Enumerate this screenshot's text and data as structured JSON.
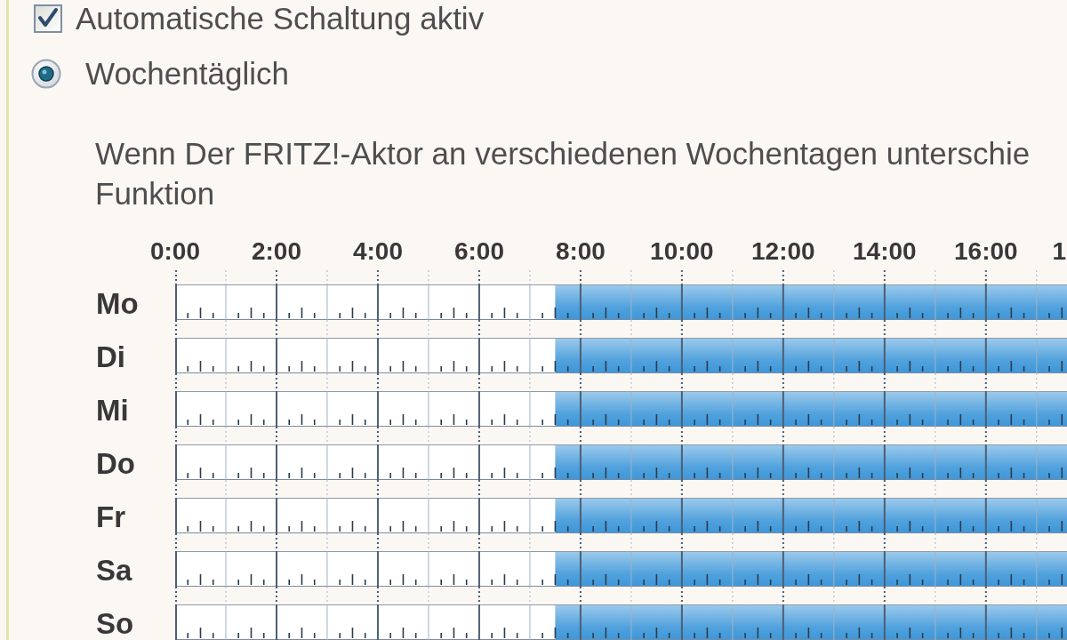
{
  "auto_switch": {
    "label": "Automatische Schaltung aktiv",
    "checked": true
  },
  "schedule_modes": [
    {
      "label": "Wochentäglich",
      "selected": true
    }
  ],
  "description_lines": [
    "Wenn Der FRITZ!-Aktor an verschiedenen Wochentagen unterschie",
    "Funktion"
  ],
  "timeline": {
    "chart_data": {
      "type": "bar",
      "orientation": "horizontal",
      "stacked": true,
      "categories": [
        "Mo",
        "Di",
        "Mi",
        "Do",
        "Fr",
        "Sa",
        "So"
      ],
      "series": [
        {
          "color": "#ffffff",
          "values": [
            7.5,
            7.5,
            7.5,
            7.5,
            7.5,
            7.5,
            7.5
          ]
        },
        {
          "color": "#3d97d9",
          "values": [
            10.1,
            10.1,
            10.1,
            10.1,
            10.1,
            10.1,
            10.1
          ]
        }
      ],
      "xlim": [
        0,
        17.6
      ],
      "xticks": [
        {
          "value": 0,
          "label": "0:00"
        },
        {
          "value": 2,
          "label": "2:00"
        },
        {
          "value": 4,
          "label": "4:00"
        },
        {
          "value": 6,
          "label": "6:00"
        },
        {
          "value": 8,
          "label": "8:00"
        },
        {
          "value": 10,
          "label": "10:00"
        },
        {
          "value": 12,
          "label": "12:00"
        },
        {
          "value": 14,
          "label": "14:00"
        },
        {
          "value": 16,
          "label": "16:00"
        }
      ]
    },
    "edge_label": "1"
  }
}
